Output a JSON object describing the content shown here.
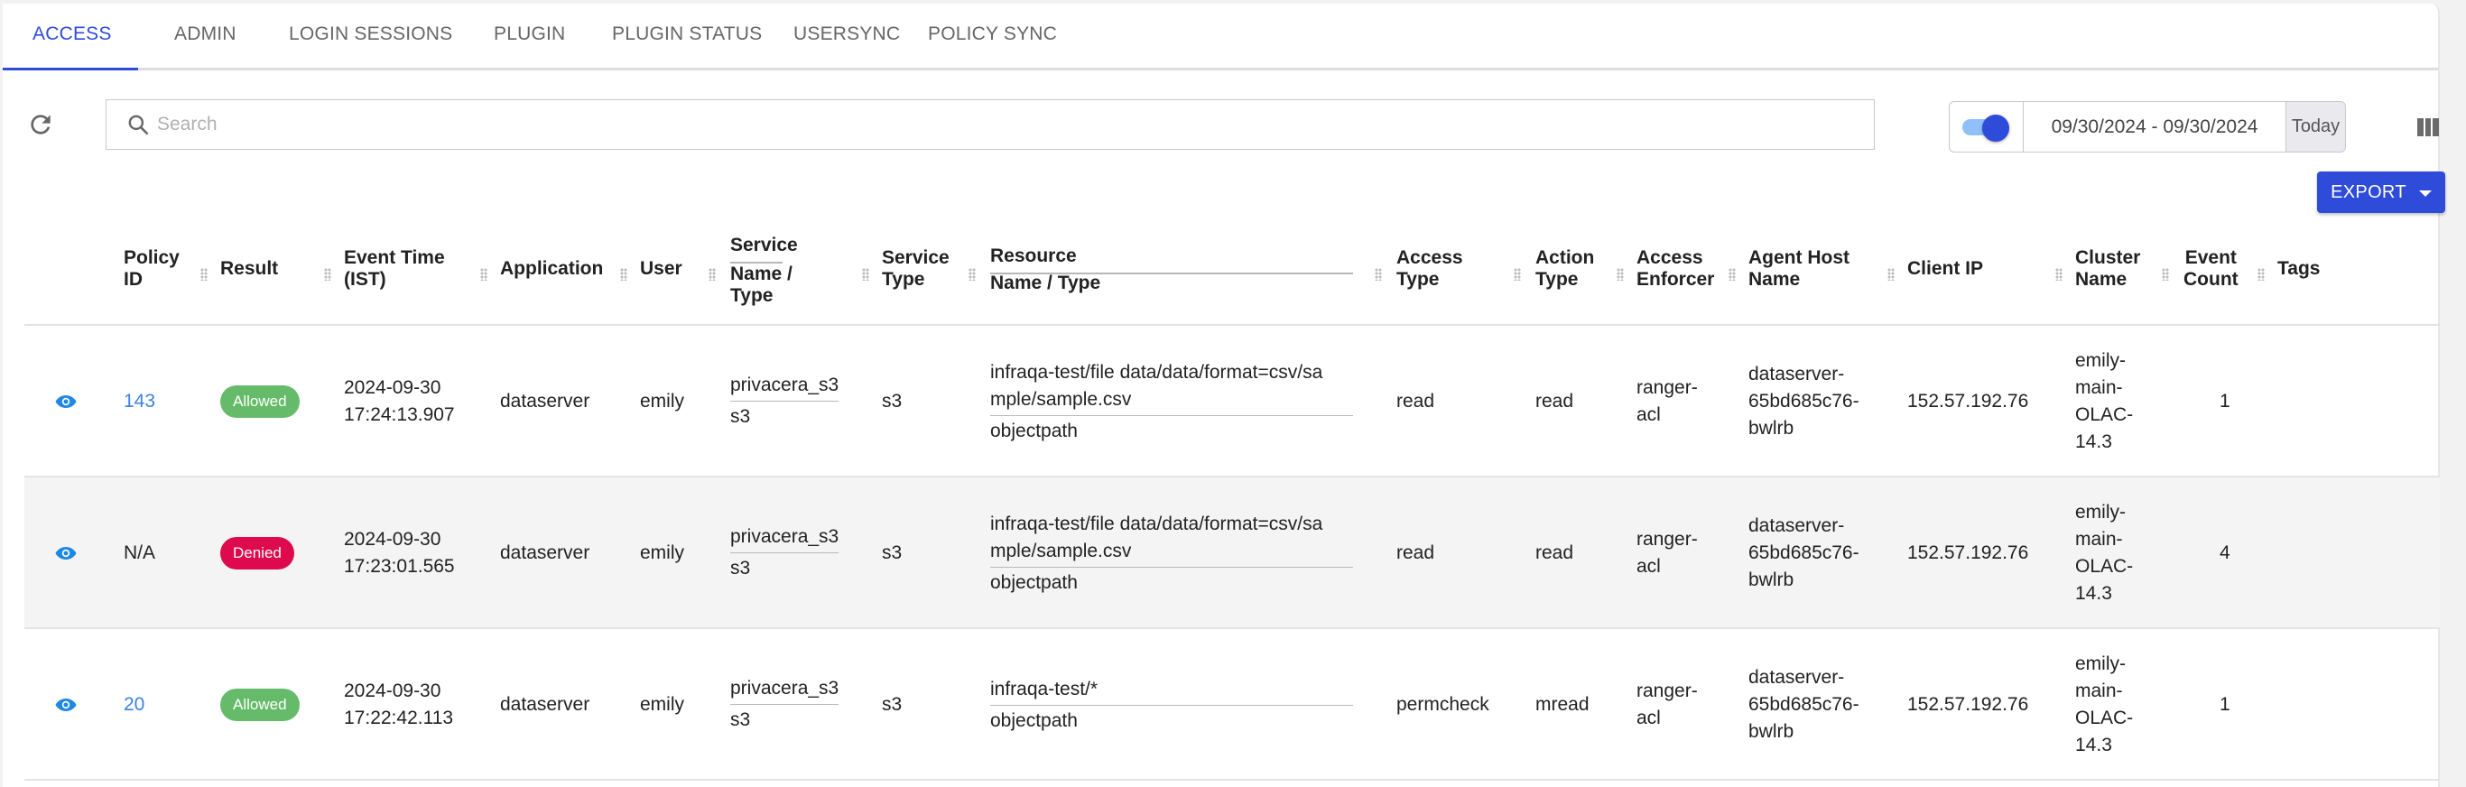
{
  "tabs": [
    {
      "label": "ACCESS",
      "active": true
    },
    {
      "label": "ADMIN",
      "active": false
    },
    {
      "label": "LOGIN SESSIONS",
      "active": false
    },
    {
      "label": "PLUGIN",
      "active": false
    },
    {
      "label": "PLUGIN STATUS",
      "active": false
    },
    {
      "label": "USERSYNC",
      "active": false
    },
    {
      "label": "POLICY SYNC",
      "active": false
    }
  ],
  "toolbar": {
    "refresh_icon": "refresh-icon",
    "search_placeholder": "Search",
    "search_value": "",
    "toggle_on": true,
    "date_range": "09/30/2024 - 09/30/2024",
    "today_label": "Today",
    "columns_icon": "view-columns-icon",
    "export_label": "EXPORT"
  },
  "colors": {
    "accent": "#2f4bd9",
    "allowed": "#66bb6a",
    "denied": "#dd0a4e",
    "link": "#3b82e0"
  },
  "table": {
    "headers": {
      "policy_id": [
        "Policy",
        "ID"
      ],
      "result": "Result",
      "event_time": [
        "Event Time",
        "(IST)"
      ],
      "application": "Application",
      "user": "User",
      "service_top": "Service",
      "service_bottom": [
        "Name /",
        "Type"
      ],
      "service_type": [
        "Service",
        "Type"
      ],
      "resource_top": "Resource",
      "resource_bottom": "Name / Type",
      "access_type": [
        "Access",
        "Type"
      ],
      "action_type": [
        "Action",
        "Type"
      ],
      "access_enforcer": [
        "Access",
        "Enforcer"
      ],
      "agent_host": [
        "Agent Host",
        "Name"
      ],
      "client_ip": "Client IP",
      "cluster_name": [
        "Cluster",
        "Name"
      ],
      "event_count": [
        "Event",
        "Count"
      ],
      "tags": "Tags"
    },
    "rows": [
      {
        "policy_id": "143",
        "policy_is_link": true,
        "result": "Allowed",
        "event_date": "2024-09-30",
        "event_time": "17:24:13.907",
        "application": "dataserver",
        "user": "emily",
        "service_name": "privacera_s3",
        "service_type_sub": "s3",
        "service_type": "s3",
        "resource_name": [
          "infraqa-test/file data/data/format=csv/sa",
          "mple/sample.csv"
        ],
        "resource_type": "objectpath",
        "access_type": "read",
        "action_type": "read",
        "access_enforcer": [
          "ranger-",
          "acl"
        ],
        "agent_host": [
          "dataserver-",
          "65bd685c76-",
          "bwlrb"
        ],
        "client_ip": "152.57.192.76",
        "cluster_name": [
          "emily-",
          "main-",
          "OLAC-",
          "14.3"
        ],
        "event_count": "1",
        "tags": ""
      },
      {
        "policy_id": "N/A",
        "policy_is_link": false,
        "result": "Denied",
        "event_date": "2024-09-30",
        "event_time": "17:23:01.565",
        "application": "dataserver",
        "user": "emily",
        "service_name": "privacera_s3",
        "service_type_sub": "s3",
        "service_type": "s3",
        "resource_name": [
          "infraqa-test/file data/data/format=csv/sa",
          "mple/sample.csv"
        ],
        "resource_type": "objectpath",
        "access_type": "read",
        "action_type": "read",
        "access_enforcer": [
          "ranger-",
          "acl"
        ],
        "agent_host": [
          "dataserver-",
          "65bd685c76-",
          "bwlrb"
        ],
        "client_ip": "152.57.192.76",
        "cluster_name": [
          "emily-",
          "main-",
          "OLAC-",
          "14.3"
        ],
        "event_count": "4",
        "tags": ""
      },
      {
        "policy_id": "20",
        "policy_is_link": true,
        "result": "Allowed",
        "event_date": "2024-09-30",
        "event_time": "17:22:42.113",
        "application": "dataserver",
        "user": "emily",
        "service_name": "privacera_s3",
        "service_type_sub": "s3",
        "service_type": "s3",
        "resource_name": [
          "infraqa-test/*"
        ],
        "resource_type": "objectpath",
        "access_type": "permcheck",
        "action_type": "mread",
        "access_enforcer": [
          "ranger-",
          "acl"
        ],
        "agent_host": [
          "dataserver-",
          "65bd685c76-",
          "bwlrb"
        ],
        "client_ip": "152.57.192.76",
        "cluster_name": [
          "emily-",
          "main-",
          "OLAC-",
          "14.3"
        ],
        "event_count": "1",
        "tags": ""
      }
    ]
  }
}
